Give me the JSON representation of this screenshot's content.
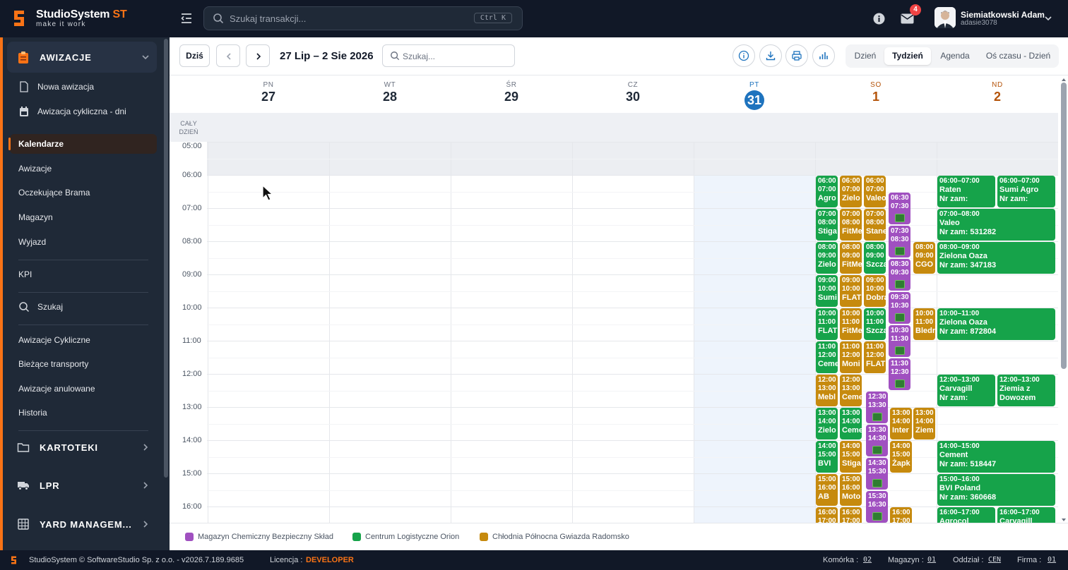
{
  "brand": {
    "title_main": "StudioSystem",
    "title_accent": "ST",
    "tagline": "make it work",
    "accent_color": "#f97316"
  },
  "topbar": {
    "search_placeholder": "Szukaj transakcji...",
    "search_shortcut": "Ctrl K",
    "mail_badge": "4",
    "user_name": "Siemiatkowski Adam",
    "user_login": "adasie3078"
  },
  "sidebar": {
    "group_awizacje": "AWIZACJE",
    "items_top": [
      "Nowa awizacja",
      "Awizacja cykliczna - dni"
    ],
    "items_main": [
      "Kalendarze",
      "Awizacje",
      "Oczekujące Brama",
      "Magazyn",
      "Wyjazd"
    ],
    "kpi": "KPI",
    "search": "Szukaj",
    "items_bottom": [
      "Awizacje Cykliczne",
      "Bieżące transporty",
      "Awizacje anulowane",
      "Historia"
    ],
    "group_kartoteki": "KARTOTEKI",
    "group_lpr": "LPR",
    "group_yard": "YARD MANAGEM..."
  },
  "toolbar": {
    "today": "Dziś",
    "range": "27 Lip – 2 Sie 2026",
    "search_placeholder": "Szukaj...",
    "views": [
      "Dzień",
      "Tydzień",
      "Agenda",
      "Oś czasu - Dzień"
    ],
    "active_view": "Tydzień"
  },
  "days": [
    {
      "dow": "PN",
      "num": "27"
    },
    {
      "dow": "WT",
      "num": "28"
    },
    {
      "dow": "ŚR",
      "num": "29"
    },
    {
      "dow": "CZ",
      "num": "30"
    },
    {
      "dow": "PT",
      "num": "31"
    },
    {
      "dow": "SO",
      "num": "1"
    },
    {
      "dow": "ND",
      "num": "2"
    }
  ],
  "allday_label": "CAŁY DZIEŃ",
  "times": [
    "05:00",
    "06:00",
    "07:00",
    "08:00",
    "09:00",
    "10:00",
    "11:00",
    "12:00",
    "13:00",
    "14:00",
    "15:00",
    "16:00"
  ],
  "legend": [
    {
      "label": "Magazyn Chemiczny Bezpieczny Skład",
      "color": "#a050c0"
    },
    {
      "label": "Centrum Logistyczne Orion",
      "color": "#16a34a"
    },
    {
      "label": "Chłodnia Północna Gwiazda Radomsko",
      "color": "#c68a0e"
    }
  ],
  "events_sunday": [
    {
      "time": "06:00–07:00",
      "title": "Raten",
      "line2": "Nr zam:",
      "color": "green"
    },
    {
      "time": "06:00–07:00",
      "title": "Sumi Agro",
      "line2": "Nr zam:",
      "color": "green"
    },
    {
      "time": "07:00–08:00",
      "title": "Valeo",
      "line2": "Nr zam: 531282",
      "color": "green"
    },
    {
      "time": "08:00–09:00",
      "title": "Zielona Oaza",
      "line2": "Nr zam: 347183",
      "color": "green"
    },
    {
      "time": "10:00–11:00",
      "title": "Zielona Oaza",
      "line2": "Nr zam: 872804",
      "color": "green"
    },
    {
      "time": "12:00–13:00",
      "title": "Carvagill",
      "line2": "Nr zam:",
      "color": "green"
    },
    {
      "time": "12:00–13:00",
      "title": "Ziemia z Dowozem",
      "line2": "",
      "color": "green"
    },
    {
      "time": "14:00–15:00",
      "title": "Cement",
      "line2": "Nr zam: 518447",
      "color": "green"
    },
    {
      "time": "15:00–16:00",
      "title": "BVI Poland",
      "line2": "Nr zam: 360668",
      "color": "green"
    },
    {
      "time": "16:00–17:00",
      "title": "Agrocol",
      "line2": "",
      "color": "green"
    },
    {
      "time": "16:00–17:00",
      "title": "Carvagill",
      "line2": "",
      "color": "green"
    }
  ],
  "events_saturday": {
    "col1": [
      {
        "t1": "06:00",
        "t2": "07:00",
        "title": "Agro",
        "color": "green"
      },
      {
        "t1": "07:00",
        "t2": "08:00",
        "title": "Stiga",
        "color": "green"
      },
      {
        "t1": "08:00",
        "t2": "09:00",
        "title": "Zielo",
        "color": "green"
      },
      {
        "t1": "09:00",
        "t2": "10:00",
        "title": "Sumi",
        "color": "green"
      },
      {
        "t1": "10:00",
        "t2": "11:00",
        "title": "FLAT",
        "color": "green"
      },
      {
        "t1": "11:00",
        "t2": "12:00",
        "title": "Ceme",
        "color": "green"
      },
      {
        "t1": "12:00",
        "t2": "13:00",
        "title": "Mebl",
        "color": "gold"
      },
      {
        "t1": "13:00",
        "t2": "14:00",
        "title": "Zielo",
        "color": "green"
      },
      {
        "t1": "14:00",
        "t2": "15:00",
        "title": "BVI",
        "color": "green"
      },
      {
        "t1": "15:00",
        "t2": "16:00",
        "title": "AB",
        "color": "gold"
      },
      {
        "t1": "16:00",
        "t2": "17:00",
        "title": "",
        "color": "gold"
      }
    ],
    "col2": [
      {
        "t1": "06:00",
        "t2": "07:00",
        "title": "Zielo",
        "color": "gold"
      },
      {
        "t1": "07:00",
        "t2": "08:00",
        "title": "FitMe",
        "color": "gold"
      },
      {
        "t1": "08:00",
        "t2": "09:00",
        "title": "FitMe",
        "color": "gold"
      },
      {
        "t1": "09:00",
        "t2": "10:00",
        "title": "FLAT",
        "color": "gold"
      },
      {
        "t1": "10:00",
        "t2": "11:00",
        "title": "FitMe",
        "color": "gold"
      },
      {
        "t1": "11:00",
        "t2": "12:00",
        "title": "Moni",
        "color": "gold"
      },
      {
        "t1": "12:00",
        "t2": "13:00",
        "title": "Ceme",
        "color": "gold"
      },
      {
        "t1": "13:00",
        "t2": "14:00",
        "title": "Ceme",
        "color": "green"
      },
      {
        "t1": "14:00",
        "t2": "15:00",
        "title": "Stiga",
        "color": "gold"
      },
      {
        "t1": "15:00",
        "t2": "16:00",
        "title": "Moto",
        "color": "gold"
      },
      {
        "t1": "16:00",
        "t2": "17:00",
        "title": "",
        "color": "gold"
      }
    ],
    "col3": [
      {
        "t1": "06:00",
        "t2": "07:00",
        "title": "Valeo",
        "color": "gold"
      },
      {
        "t1": "07:00",
        "t2": "08:00",
        "title": "Stane",
        "color": "gold"
      },
      {
        "t1": "08:00",
        "t2": "09:00",
        "title": "Szcza",
        "color": "green"
      },
      {
        "t1": "09:00",
        "t2": "10:00",
        "title": "Dobra",
        "color": "gold"
      },
      {
        "t1": "10:00",
        "t2": "11:00",
        "title": "Szcza",
        "color": "green"
      },
      {
        "t1": "11:00",
        "t2": "12:00",
        "title": "FLAT",
        "color": "gold"
      }
    ],
    "purple": [
      {
        "t1": "06:30",
        "t2": "07:30"
      },
      {
        "t1": "07:30",
        "t2": "08:30"
      },
      {
        "t1": "08:30",
        "t2": "09:30"
      },
      {
        "t1": "09:30",
        "t2": "10:30"
      },
      {
        "t1": "10:30",
        "t2": "11:30"
      },
      {
        "t1": "11:30",
        "t2": "12:30"
      },
      {
        "t1": "12:30",
        "t2": "13:30"
      },
      {
        "t1": "13:30",
        "t2": "14:30"
      },
      {
        "t1": "14:30",
        "t2": "15:30"
      },
      {
        "t1": "15:30",
        "t2": "16:30"
      }
    ],
    "extra": [
      {
        "t1": "08:00",
        "t2": "09:00",
        "title": "CGO",
        "color": "gold"
      },
      {
        "t1": "10:00",
        "t2": "11:00",
        "title": "Bledr",
        "color": "gold"
      },
      {
        "t1": "13:00",
        "t2": "14:00",
        "title": "Inter",
        "color": "gold"
      },
      {
        "t1": "13:00",
        "t2": "14:00",
        "title": "Ziem",
        "color": "gold"
      },
      {
        "t1": "14:00",
        "t2": "15:00",
        "title": "Żapk",
        "color": "gold"
      },
      {
        "t1": "16:00",
        "t2": "17:00",
        "title": "",
        "color": "gold"
      }
    ]
  },
  "footer": {
    "copyright": "StudioSystem © SoftwareStudio Sp. z o.o. - v2026.7.189.9685",
    "license_label": "Licencja :",
    "license_value": "DEVELOPER",
    "cell_label": "Komórka :",
    "cell_value": "02",
    "warehouse_label": "Magazyn :",
    "warehouse_value": "01",
    "branch_label": "Oddział :",
    "branch_value": "CEN",
    "company_label": "Firma :",
    "company_value": "01"
  }
}
